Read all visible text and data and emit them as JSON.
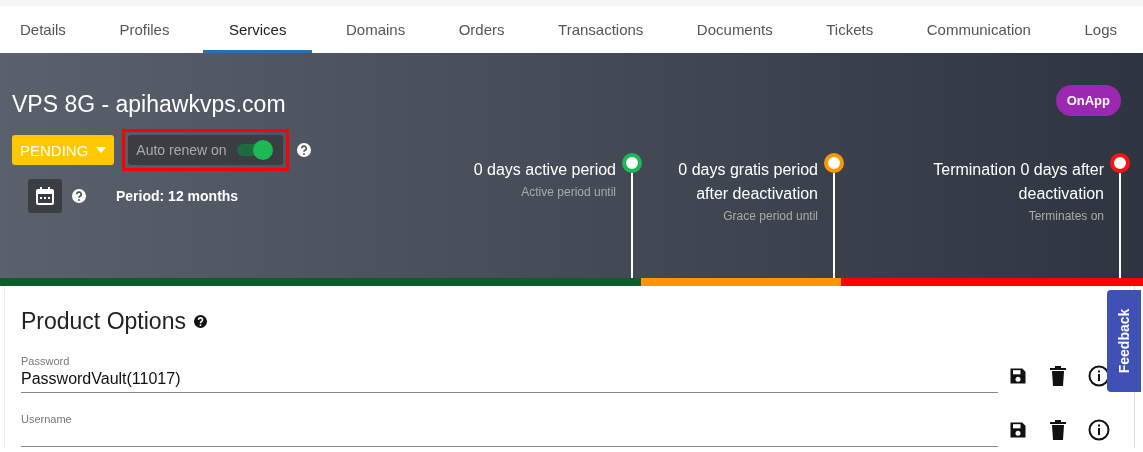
{
  "tabs": [
    {
      "label": "Details",
      "selected": false
    },
    {
      "label": "Profiles",
      "selected": false
    },
    {
      "label": "Services",
      "selected": true
    },
    {
      "label": "Domains",
      "selected": false
    },
    {
      "label": "Orders",
      "selected": false
    },
    {
      "label": "Transactions",
      "selected": false
    },
    {
      "label": "Documents",
      "selected": false
    },
    {
      "label": "Tickets",
      "selected": false
    },
    {
      "label": "Communication",
      "selected": false
    },
    {
      "label": "Logs",
      "selected": false
    }
  ],
  "service": {
    "title": "VPS 8G - apihawkvps.com",
    "status": "PENDING",
    "auto_renew": {
      "label": "Auto renew on",
      "on": true,
      "highlighted": true
    },
    "period": "Period: 12 months",
    "provider": "OnApp"
  },
  "milestones": [
    {
      "kind": "active",
      "title": "0 days active period",
      "subtitle": "Active period until",
      "color": "#1db954"
    },
    {
      "kind": "grace",
      "title": "0 days gratis period after deactivation",
      "subtitle": "Grace period until",
      "color": "#ff9800"
    },
    {
      "kind": "termination",
      "title": "Termination 0 days after deactivation",
      "subtitle": "Terminates on",
      "color": "#ff1111"
    }
  ],
  "product_options": {
    "title": "Product Options",
    "fields": [
      {
        "label": "Password",
        "value": "PasswordVault(11017)"
      },
      {
        "label": "Username"
      }
    ]
  },
  "feedback": "Feedback"
}
